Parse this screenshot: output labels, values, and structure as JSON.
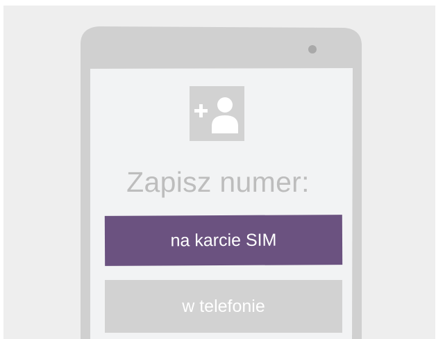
{
  "dialog": {
    "title": "Zapisz numer:",
    "icon": "add-contact-icon",
    "options": {
      "sim_label": "na karcie SIM",
      "phone_label": "w telefonie"
    }
  },
  "colors": {
    "background": "#eeeeee",
    "phone_body": "#d0d0d0",
    "screen": "#f2f3f4",
    "accent": "#6b5280",
    "secondary_button": "#d2d2d2",
    "muted_text": "#bdbdbd"
  }
}
